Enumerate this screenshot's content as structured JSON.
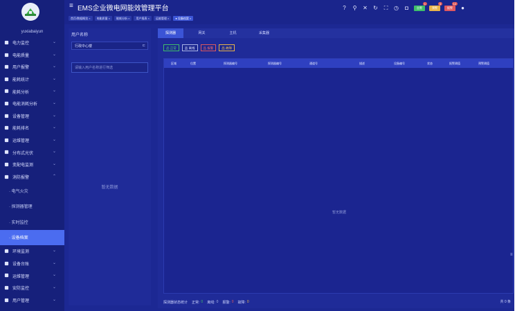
{
  "colors": {
    "background": "#1c2893",
    "sidebar": "#16207b",
    "accent": "#4b6cf0",
    "normal": "#3fbf6a",
    "offline": "#aab4e8",
    "alarm": "#e0585f",
    "fault": "#e8b34a"
  },
  "app": {
    "title": "EMS企业微电网能效管理平台",
    "menu_icon": "hamburger-icon"
  },
  "breadcrumbs": [
    {
      "label": "首页/数据概览 ×"
    },
    {
      "label": "电能质量 ×"
    },
    {
      "label": "能耗分析 ×"
    },
    {
      "label": "用户报表 ×"
    },
    {
      "label": "运维管理 ×"
    },
    {
      "label": "● 设备档案 ×"
    }
  ],
  "header_icons": [
    "help-icon",
    "search-icon",
    "mute-icon",
    "refresh-icon",
    "fullscreen-icon",
    "clock-icon",
    "shirt-icon"
  ],
  "header_badges": [
    {
      "label": "告警",
      "count": "1",
      "color": "#3fbf6a"
    },
    {
      "label": "预警",
      "count": "3",
      "color": "#e8b34a"
    },
    {
      "label": "报警",
      "count": "12",
      "color": "#e0585f"
    }
  ],
  "user": {
    "name": "yuxiabaiyun",
    "avatar": "user-icon"
  },
  "sidebar": {
    "items": [
      {
        "label": "电力监控",
        "icon": "monitor-icon"
      },
      {
        "label": "电能质量",
        "icon": "quality-icon"
      },
      {
        "label": "用户报警",
        "icon": "alarm-icon"
      },
      {
        "label": "能耗统计",
        "icon": "stats-icon"
      },
      {
        "label": "能耗分析",
        "icon": "analysis-icon"
      },
      {
        "label": "电能消耗分析",
        "icon": "consume-icon"
      },
      {
        "label": "设备管理",
        "icon": "device-icon"
      },
      {
        "label": "能耗排名",
        "icon": "rank-icon"
      },
      {
        "label": "运维管理",
        "icon": "ops-icon"
      },
      {
        "label": "分布式光伏",
        "icon": "solar-icon"
      },
      {
        "label": "变配电监测",
        "icon": "substation-icon"
      },
      {
        "label": "消防报警",
        "icon": "fire-icon",
        "expanded": true
      }
    ],
    "sub_items": [
      {
        "label": "· 电气火灾"
      },
      {
        "label": "· 探测器管理"
      },
      {
        "label": "· 实时监控"
      },
      {
        "label": "· 设备档案",
        "active": true
      }
    ],
    "bottom_items": [
      {
        "label": "环境监测",
        "icon": "env-icon"
      },
      {
        "label": "设备台账",
        "icon": "ledger-icon"
      },
      {
        "label": "运维管理",
        "icon": "maint-icon"
      },
      {
        "label": "安防监控",
        "icon": "security-icon"
      },
      {
        "label": "用户管理",
        "icon": "users-icon"
      }
    ]
  },
  "left_panel": {
    "heading": "用户名称",
    "select_value": "行政中心楼",
    "input_placeholder": "请输入用户名称进行筛选",
    "empty_text": "暂无数据"
  },
  "tabs": [
    {
      "label": "探测器",
      "active": true
    },
    {
      "label": "网关"
    },
    {
      "label": "主机"
    },
    {
      "label": "采集器"
    }
  ],
  "actions": [
    {
      "label": "品 正常",
      "kind": "g"
    },
    {
      "label": "品 离线",
      "kind": "w"
    },
    {
      "label": "品 报警",
      "kind": "r"
    },
    {
      "label": "品 故障",
      "kind": "y"
    }
  ],
  "table": {
    "columns": [
      "区域",
      "位置",
      "探测器编号",
      "探测器编号",
      "通道号",
      "描述",
      "设备编号",
      "状态",
      "报警阈值",
      "预警阈值"
    ],
    "empty_text": "暂无数据"
  },
  "footer": {
    "label": "探测器状态统计",
    "stats": [
      {
        "label": "正常:",
        "value": "0",
        "color": "#3fbf6a"
      },
      {
        "label": "离线:",
        "value": "0",
        "color": "#aab4e8"
      },
      {
        "label": "报警:",
        "value": "0",
        "color": "#e0585f"
      },
      {
        "label": "故障:",
        "value": "0",
        "color": "#e8b34a"
      }
    ],
    "total": "共 0 条"
  },
  "scroll_hint": "≡"
}
